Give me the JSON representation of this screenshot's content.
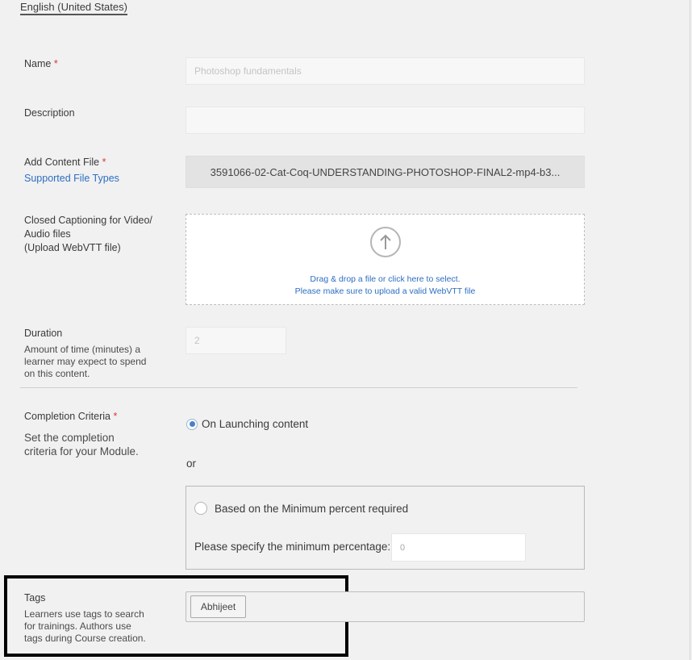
{
  "language_tab": "English (United States)",
  "name": {
    "label": "Name",
    "required": "*",
    "placeholder": "Photoshop fundamentals"
  },
  "description": {
    "label": "Description",
    "value": ""
  },
  "content_file": {
    "label": "Add Content File",
    "required": "*",
    "link": "Supported File Types",
    "filename": "3591066-02-Cat-Coq-UNDERSTANDING-PHOTOSHOP-FINAL2-mp4-b3..."
  },
  "captions": {
    "label_line1": "Closed Captioning for Video/",
    "label_line2": "Audio files",
    "label_line3": "(Upload WebVTT file)",
    "drop_line1": "Drag & drop a file or click here to select.",
    "drop_line2": "Please make sure to upload a valid WebVTT file",
    "icon": "upload-arrow-icon"
  },
  "duration": {
    "label": "Duration",
    "help_line1": "Amount of time (minutes) a",
    "help_line2": "learner may expect to spend",
    "help_line3": "on this content.",
    "placeholder": "2"
  },
  "completion": {
    "label": "Completion Criteria",
    "required": "*",
    "help_line1": "Set the completion",
    "help_line2": "criteria for your Module.",
    "option1": "On Launching content",
    "or_text": "or",
    "option2": "Based on the Minimum percent required",
    "min_label": "Please specify the minimum percentage:",
    "min_placeholder": "0",
    "selected": "option1"
  },
  "tags": {
    "label": "Tags",
    "help_line1": "Learners use tags to search",
    "help_line2": "for trainings. Authors use",
    "help_line3": "tags during Course creation.",
    "chips": [
      "Abhijeet"
    ]
  },
  "colors": {
    "background": "#f1f1f1",
    "link": "#2d6ec2",
    "required": "#d7373f",
    "radio_selected": "#4a7fc9",
    "highlight_box": "#000000"
  }
}
